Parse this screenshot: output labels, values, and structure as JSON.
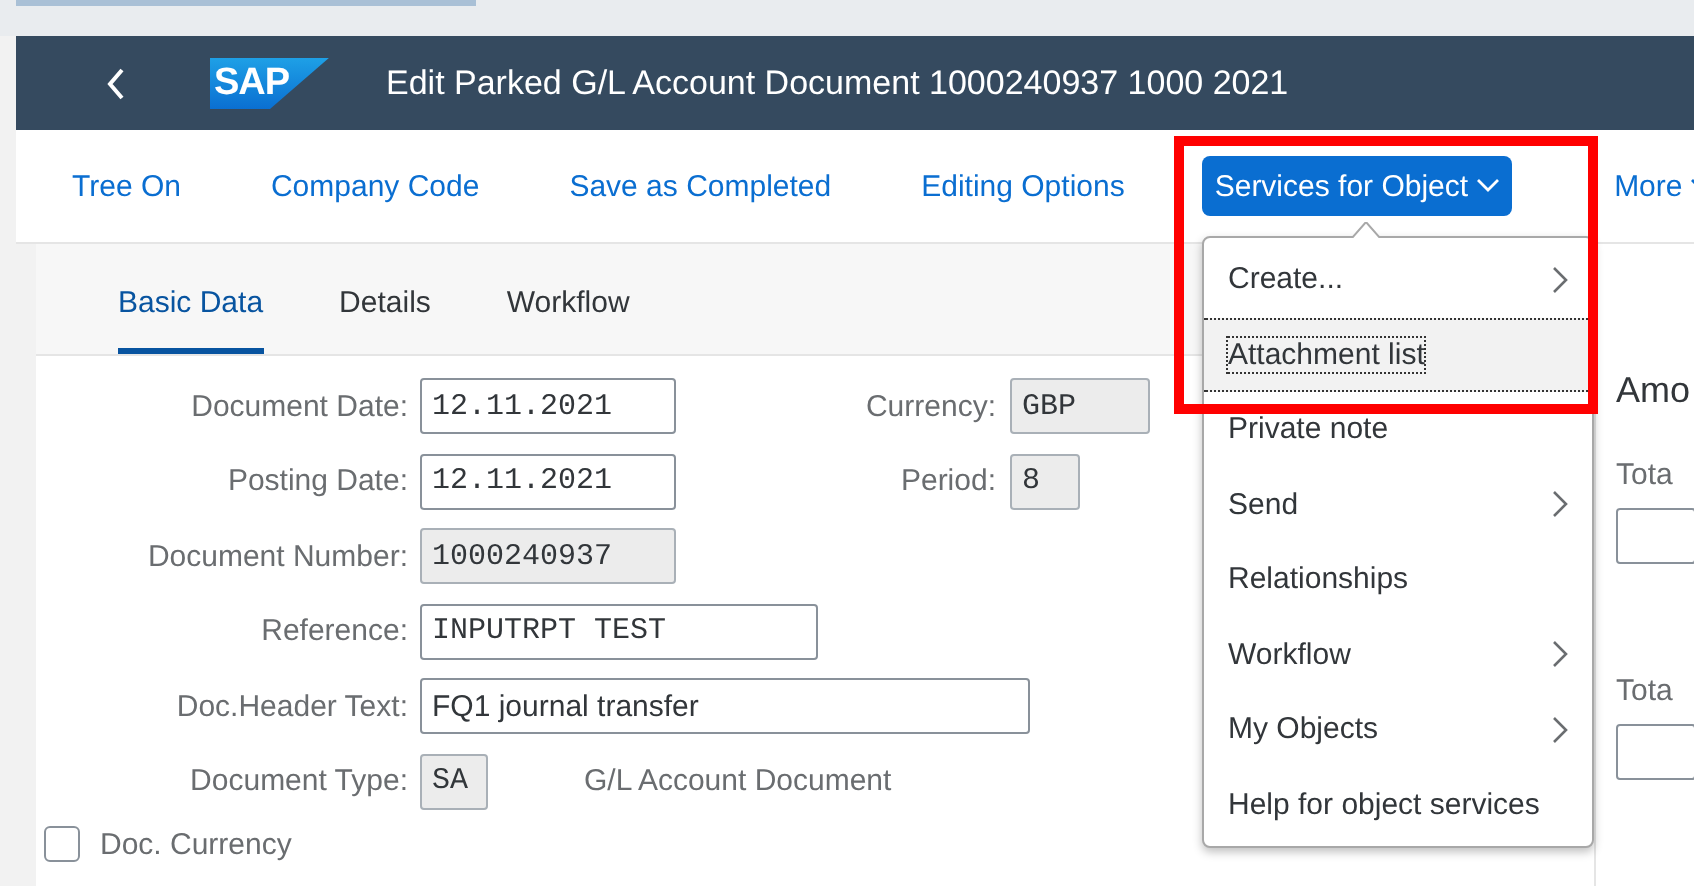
{
  "header": {
    "logo": "SAP",
    "title": "Edit Parked G/L Account Document 1000240937 1000 2021"
  },
  "toolbar": [
    {
      "label": "Tree On",
      "selected": false,
      "has_menu": false
    },
    {
      "label": "Company Code",
      "selected": false,
      "has_menu": false
    },
    {
      "label": "Save as Completed",
      "selected": false,
      "has_menu": false
    },
    {
      "label": "Editing Options",
      "selected": false,
      "has_menu": false
    },
    {
      "label": "Services for Object",
      "selected": true,
      "has_menu": true
    },
    {
      "label": "More",
      "selected": false,
      "has_menu": true
    }
  ],
  "tabs": [
    {
      "label": "Basic Data",
      "selected": true
    },
    {
      "label": "Details",
      "selected": false
    },
    {
      "label": "Workflow",
      "selected": false
    }
  ],
  "form": {
    "rows": [
      {
        "label": "Document Date:",
        "value": "12.11.2021",
        "readonly": false,
        "side": {
          "label": "Currency:",
          "value": "GBP",
          "readonly": true
        }
      },
      {
        "label": "Posting Date:",
        "value": "12.11.2021",
        "readonly": false,
        "side": {
          "label": "Period:",
          "value": "8",
          "readonly": true
        }
      },
      {
        "label": "Document Number:",
        "value": "1000240937",
        "readonly": true
      },
      {
        "label": "Reference:",
        "value": "INPUTRPT TEST",
        "readonly": false
      },
      {
        "label": "Doc.Header Text:",
        "value": "FQ1 journal transfer",
        "readonly": false
      },
      {
        "label": "Document Type:",
        "value": "SA",
        "readonly": true,
        "description": "G/L Account Document"
      }
    ],
    "checkbox": {
      "label": "Doc. Currency",
      "checked": false
    }
  },
  "side_panel": {
    "heading": "Amo",
    "fields": [
      {
        "label": "Tota"
      },
      {
        "label": "Tota"
      }
    ]
  },
  "menu": {
    "items": [
      {
        "label": "Create...",
        "has_submenu": true,
        "focused": false
      },
      {
        "label": "Attachment list",
        "has_submenu": false,
        "focused": true
      },
      {
        "label": "Private note",
        "has_submenu": false,
        "focused": false
      },
      {
        "label": "Send",
        "has_submenu": true,
        "focused": false
      },
      {
        "label": "Relationships",
        "has_submenu": false,
        "focused": false
      },
      {
        "label": "Workflow",
        "has_submenu": true,
        "focused": false
      },
      {
        "label": "My Objects",
        "has_submenu": true,
        "focused": false
      },
      {
        "label": "Help for object services",
        "has_submenu": false,
        "focused": false
      }
    ]
  },
  "highlight": {
    "shown": true
  }
}
